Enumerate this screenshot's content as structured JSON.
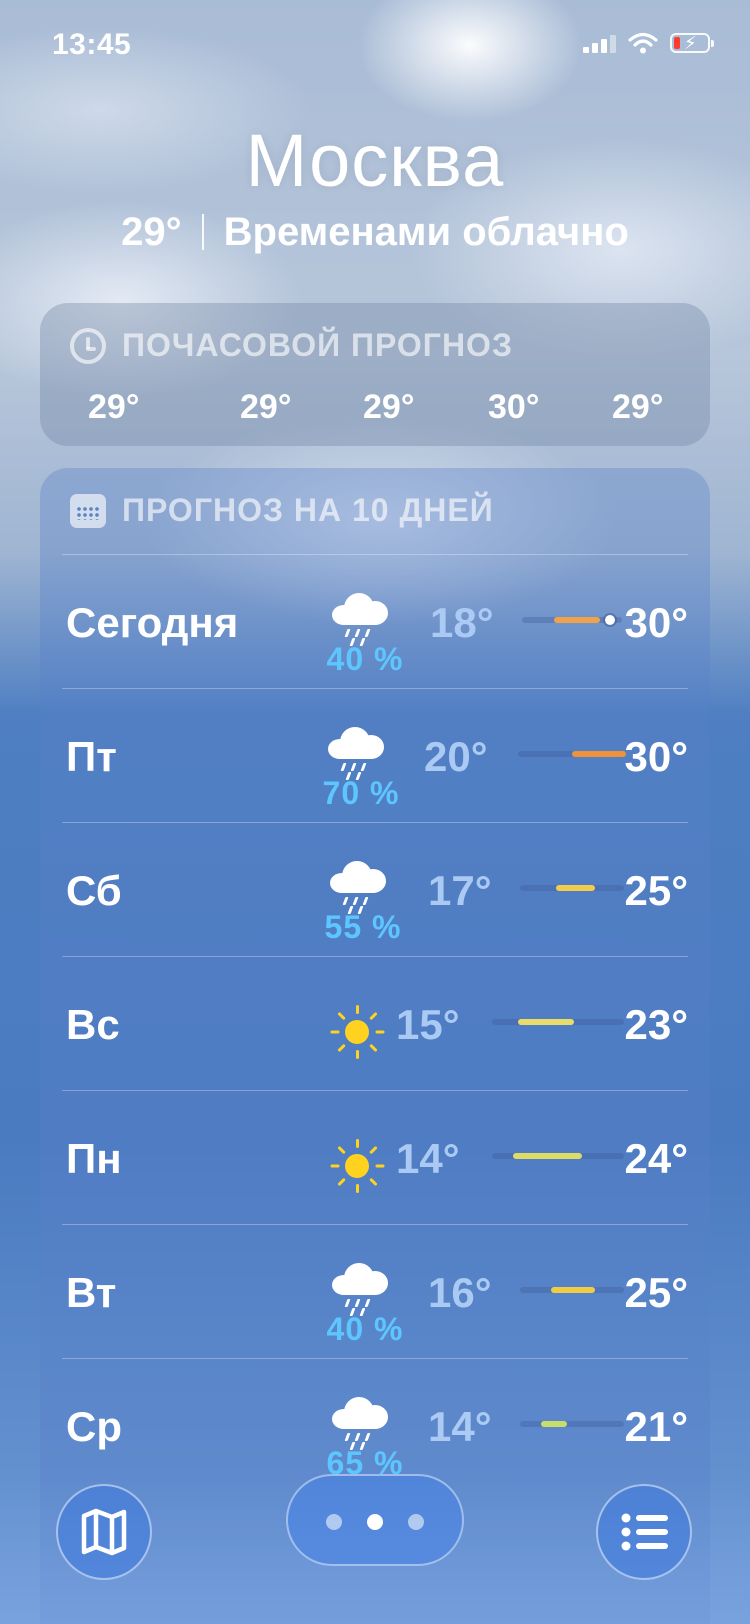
{
  "status_bar": {
    "time": "13:45",
    "icons": [
      "cellular-signal-icon",
      "wifi-icon",
      "battery-charging-icon"
    ]
  },
  "header": {
    "city": "Москва",
    "current_temp": "29°",
    "condition": "Временами облачно"
  },
  "hourly": {
    "title": "ПОЧАСОВОЙ ПРОГНОЗ",
    "icon": "clock-icon",
    "temps": [
      "29°",
      "29°",
      "29°",
      "30°",
      "29°"
    ]
  },
  "daily": {
    "title": "ПРОГНОЗ НА 10 ДНЕЙ",
    "icon": "calendar-icon",
    "days": [
      {
        "day": "Сегодня",
        "icon": "cloud-rain-icon",
        "precip": "40 %",
        "low": "18°",
        "high": "30°",
        "range_start": 0.32,
        "range_end": 0.78,
        "current": 0.88,
        "bar_color": "#f0a24a"
      },
      {
        "day": "Пт",
        "icon": "cloud-rain-icon",
        "precip": "70 %",
        "low": "20°",
        "high": "30°",
        "range_start": 0.5,
        "range_end": 1.0,
        "bar_color": "#f0923a"
      },
      {
        "day": "Сб",
        "icon": "cloud-rain-icon",
        "precip": "55 %",
        "low": "17°",
        "high": "25°",
        "range_start": 0.35,
        "range_end": 0.72,
        "bar_color": "#f2cc4a"
      },
      {
        "day": "Вс",
        "icon": "sun-icon",
        "precip": "",
        "low": "15°",
        "high": "23°",
        "range_start": 0.2,
        "range_end": 0.62,
        "bar_color": "#e9dc6a"
      },
      {
        "day": "Пн",
        "icon": "sun-icon",
        "precip": "",
        "low": "14°",
        "high": "24°",
        "range_start": 0.16,
        "range_end": 0.68,
        "bar_color": "#dcdc66"
      },
      {
        "day": "Вт",
        "icon": "cloud-rain-icon",
        "precip": "40 %",
        "low": "16°",
        "high": "25°",
        "range_start": 0.3,
        "range_end": 0.72,
        "bar_color": "#f0cc44"
      },
      {
        "day": "Ср",
        "icon": "cloud-rain-icon",
        "precip": "65 %",
        "low": "14°",
        "high": "21°",
        "range_start": 0.2,
        "range_end": 0.45,
        "bar_color": "#c9de6a"
      }
    ]
  },
  "toolbar": {
    "map_icon": "map-icon",
    "list_icon": "list-icon",
    "pages": 3,
    "active_page": 1
  }
}
